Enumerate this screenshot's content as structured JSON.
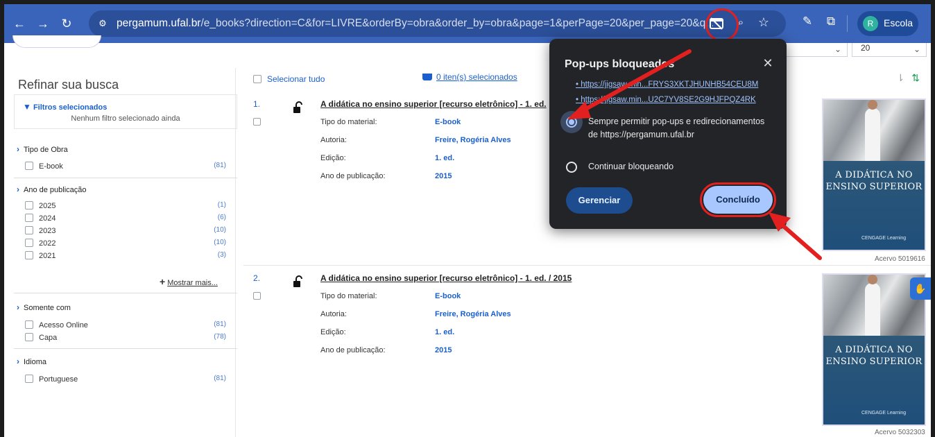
{
  "browser": {
    "url_host": "pergamum.ufal.br",
    "url_rest": "/e_books?direction=C&for=LIVRE&orderBy=obra&order_by=obra&page=1&perPage=20&per_page=20&q...",
    "profile_initial": "R",
    "profile_name": "Escola"
  },
  "page": {
    "per_page_value": "20"
  },
  "sidebar": {
    "title": "Refinar sua busca",
    "filters_title": "Filtros selecionados",
    "filters_none": "Nenhum filtro selecionado ainda",
    "sections": [
      {
        "label": "Tipo de Obra",
        "options": [
          {
            "label": "E-book",
            "count": "(81)"
          }
        ]
      },
      {
        "label": "Ano de publicação",
        "options": [
          {
            "label": "2025",
            "count": "(1)"
          },
          {
            "label": "2024",
            "count": "(6)"
          },
          {
            "label": "2023",
            "count": "(10)"
          },
          {
            "label": "2022",
            "count": "(10)"
          },
          {
            "label": "2021",
            "count": "(3)"
          }
        ]
      },
      {
        "label": "Somente com",
        "options": [
          {
            "label": "Acesso Online",
            "count": "(81)"
          },
          {
            "label": "Capa",
            "count": "(78)"
          }
        ]
      },
      {
        "label": "Idioma",
        "options": [
          {
            "label": "Portuguese",
            "count": "(81)"
          }
        ]
      }
    ],
    "show_more": "Mostrar mais..."
  },
  "results": {
    "select_all": "Selecionar tudo",
    "selected_items": "0 iten(s) selecionados",
    "fields": {
      "type": "Tipo do material:",
      "author": "Autoria:",
      "edition": "Edição:",
      "year": "Ano de publicação:"
    },
    "items": [
      {
        "num": "1.",
        "title": "A didática no ensino superior [recurso eletrônico] - 1. ed.",
        "type": "E-book",
        "author": "Freire, Rogéria Alves",
        "edition": "1. ed.",
        "year": "2015",
        "cover_title": "A DIDÁTICA NO ENSINO SUPERIOR",
        "cover_publisher": "CENGAGE Learning",
        "acervo": "Acervo 5019616"
      },
      {
        "num": "2.",
        "title": "A didática no ensino superior [recurso eletrônico] - 1. ed. / 2015",
        "type": "E-book",
        "author": "Freire, Rogéria Alves",
        "edition": "1. ed.",
        "year": "2015",
        "cover_title": "A DIDÁTICA NO ENSINO SUPERIOR",
        "cover_publisher": "CENGAGE Learning",
        "acervo": "Acervo 5032303"
      }
    ]
  },
  "popup": {
    "title": "Pop-ups bloqueados",
    "links": [
      "https://jigsaw.min...FRYS3XKTJHUNHB54CEU8M",
      "https://jigsaw.min...U2C7YV8SE2G9HJFPQZ4RK"
    ],
    "option_allow": "Sempre permitir pop-ups e redirecionamentos de https://pergamum.ufal.br",
    "option_block": "Continuar bloqueando",
    "manage_label": "Gerenciar",
    "done_label": "Concluído"
  },
  "colors": {
    "browser_bar": "#3a64b9",
    "link_blue": "#1a5fcc",
    "popup_bg": "#222427",
    "accent_light_blue": "#a9c7ff",
    "annotation_red": "#e1201f"
  }
}
